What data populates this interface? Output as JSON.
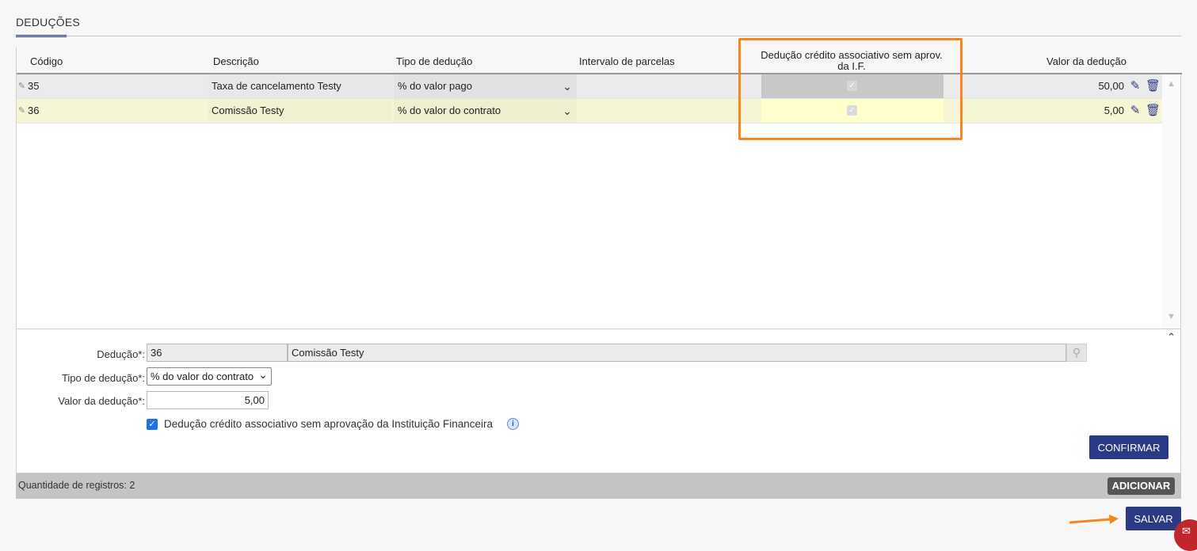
{
  "section": {
    "title": "DEDUÇÕES"
  },
  "table": {
    "columns": {
      "codigo": "Código",
      "descricao": "Descrição",
      "tipo": "Tipo de dedução",
      "intervalo": "Intervalo de parcelas",
      "credito": "Dedução crédito associativo sem aprov. da I.F.",
      "valor": "Valor da dedução"
    },
    "rows": [
      {
        "codigo": "35",
        "descricao": "Taxa de cancelamento Testy",
        "tipo": "% do valor pago",
        "intervalo": "",
        "credito_checked": true,
        "valor": "50,00"
      },
      {
        "codigo": "36",
        "descricao": "Comissão Testy",
        "tipo": "% do valor do contrato",
        "intervalo": "",
        "credito_checked": true,
        "valor": "5,00"
      }
    ]
  },
  "form": {
    "deducao_label": "Dedução*:",
    "deducao_code": "36",
    "deducao_desc": "Comissão Testy",
    "tipo_label": "Tipo de dedução*:",
    "tipo_value": "% do valor do contrato",
    "valor_label": "Valor da dedução*:",
    "valor_value": "5,00",
    "checkbox_label": "Dedução crédito associativo sem aprovação da Instituição Financeira",
    "checkbox_checked": true,
    "confirm_button": "CONFIRMAR"
  },
  "footer": {
    "count_text": "Quantidade de registros: 2",
    "add_button": "ADICIONAR"
  },
  "save_button": "SALVAR",
  "colors": {
    "primary": "#2b3a85",
    "highlight": "#f5871f",
    "selected_row": "#f6f6d6"
  },
  "icons": [
    "pencil-icon",
    "edit-icon",
    "trash-icon",
    "search-icon",
    "info-icon",
    "chevron-down-icon",
    "collapse-icon",
    "chat-icon"
  ]
}
